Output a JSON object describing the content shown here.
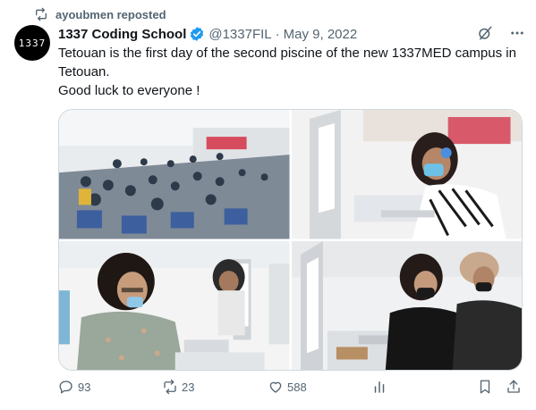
{
  "repost": {
    "label": "ayoubmen reposted",
    "icon": "repost-icon"
  },
  "author": {
    "avatar_text": "1337",
    "name": "1337 Coding School",
    "handle": "@1337FIL",
    "separator": "·",
    "date": "May 9, 2022",
    "verified_color": "#1d9bf0"
  },
  "tweet": {
    "lines": [
      "Tetouan is the first day of the second piscine of the new 1337MED campus in Tetouan.",
      "Good luck to everyone !"
    ]
  },
  "media": [
    {
      "name": "photo-auditorium",
      "alt_icon": "image-icon"
    },
    {
      "name": "photo-student-headset",
      "alt_icon": "image-icon"
    },
    {
      "name": "photo-student-glasses",
      "alt_icon": "image-icon"
    },
    {
      "name": "photo-students-masks",
      "alt_icon": "image-icon"
    }
  ],
  "actions": {
    "replies": "93",
    "reposts": "23",
    "likes": "588"
  },
  "colors": {
    "muted": "#536471",
    "text": "#0f1419",
    "border": "#cfd9de"
  }
}
